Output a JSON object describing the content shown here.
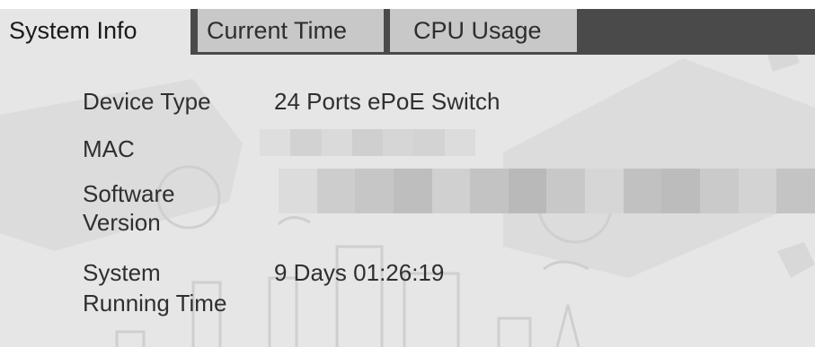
{
  "tabs": [
    {
      "label": "System Info"
    },
    {
      "label": "Current Time"
    },
    {
      "label": "CPU Usage"
    }
  ],
  "info": {
    "device_type_label": "Device Type",
    "device_type_value": "24 Ports ePoE Switch",
    "mac_label": "MAC",
    "software_label_line1": "Software",
    "software_label_line2": "Version",
    "running_label_line1": "System",
    "running_label_line2": "Running Time",
    "running_value": "9 Days 01:26:19"
  }
}
